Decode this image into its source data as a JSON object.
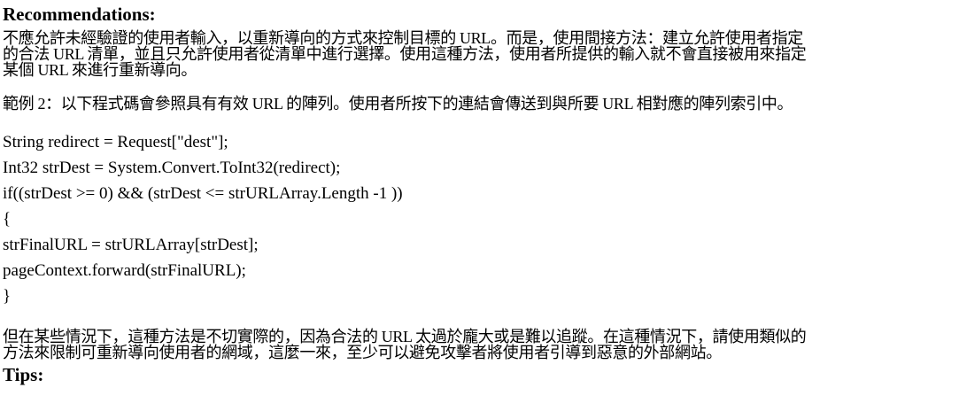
{
  "recommendations": {
    "heading": "Recommendations:",
    "paragraph1_lines": [
      "不應允許未經驗證的使用者輸入，以重新導向的方式來控制目標的 URL。而是，使用間接方法：建立允許使用者指定",
      "的合法 URL 清單，並且只允許使用者從清單中進行選擇。使用這種方法，使用者所提供的輸入就不會直接被用來指定",
      "某個 URL 來進行重新導向。"
    ],
    "example_text": "範例 2：以下程式碼會參照具有有效 URL 的陣列。使用者所按下的連結會傳送到與所要 URL 相對應的陣列索引中。",
    "code_lines": [
      "String redirect = Request[\"dest\"];",
      "Int32 strDest = System.Convert.ToInt32(redirect);",
      "if((strDest >= 0) && (strDest <= strURLArray.Length -1 ))",
      "{",
      "strFinalURL = strURLArray[strDest];",
      "pageContext.forward(strFinalURL);",
      "}"
    ],
    "closing_lines": [
      "但在某些情況下，這種方法是不切實際的，因為合法的 URL 太過於龐大或是難以追蹤。在這種情況下，請使用類似的",
      "方法來限制可重新導向使用者的網域，這麼一來，至少可以避免攻擊者將使用者引導到惡意的外部網站。"
    ]
  },
  "tips": {
    "heading": "Tips:"
  }
}
